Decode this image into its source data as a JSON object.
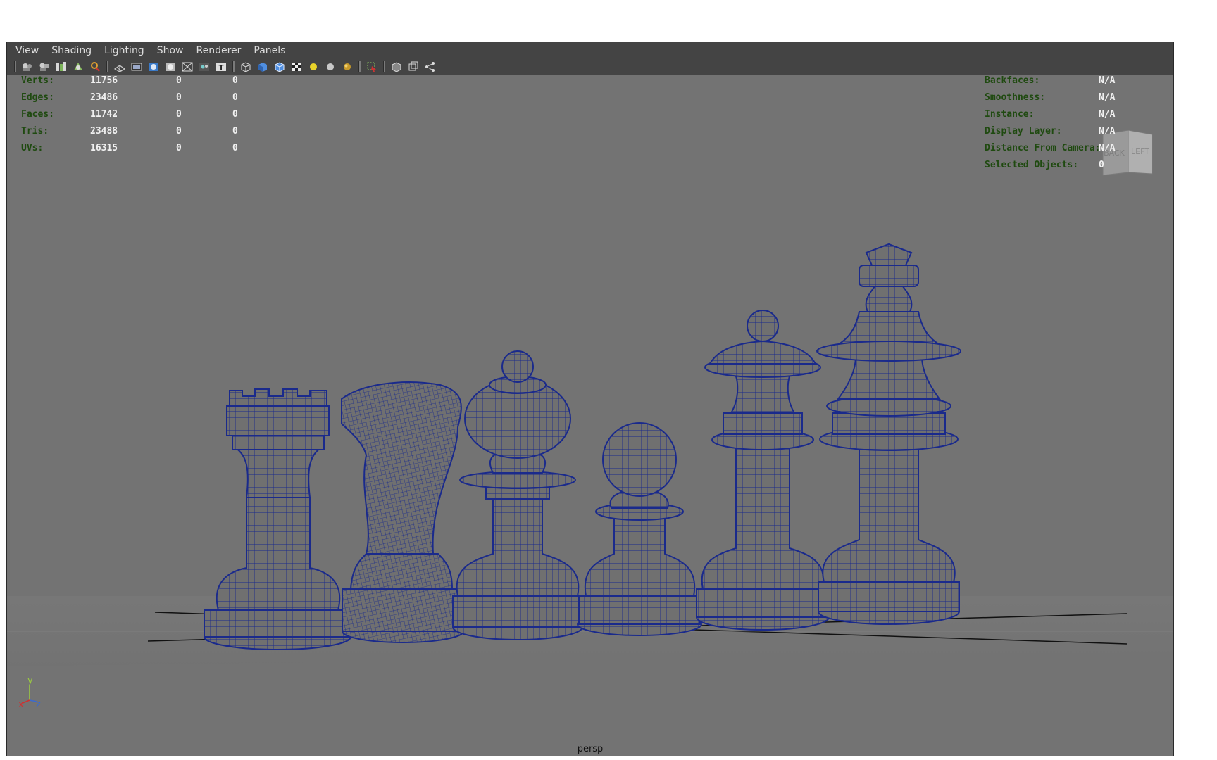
{
  "menubar": {
    "items": [
      "View",
      "Shading",
      "Lighting",
      "Show",
      "Renderer",
      "Panels"
    ]
  },
  "toolbar": {
    "icons": [
      "camera-select-icon",
      "camera-attributes-icon",
      "bookmarks-icon",
      "image-plane-icon",
      "2d-pan-zoom-icon",
      "grid-icon",
      "film-gate-icon",
      "resolution-gate-icon",
      "gate-mask-icon",
      "field-chart-icon",
      "safe-action-icon",
      "safe-title-icon",
      "wireframe-icon",
      "smooth-shade-icon",
      "wireframe-on-shaded-icon",
      "textured-icon",
      "use-default-light-icon",
      "shadows-icon",
      "screen-space-ao-icon",
      "isolate-select-icon",
      "xray-icon",
      "xray-joints-icon",
      "xray-components-icon"
    ]
  },
  "hud_left": {
    "rows": [
      {
        "label": "Verts:",
        "v1": "11756",
        "v2": "0",
        "v3": "0"
      },
      {
        "label": "Edges:",
        "v1": "23486",
        "v2": "0",
        "v3": "0"
      },
      {
        "label": "Faces:",
        "v1": "11742",
        "v2": "0",
        "v3": "0"
      },
      {
        "label": "Tris:",
        "v1": "23488",
        "v2": "0",
        "v3": "0"
      },
      {
        "label": "UVs:",
        "v1": "16315",
        "v2": "0",
        "v3": "0"
      }
    ]
  },
  "hud_right": {
    "rows": [
      {
        "label": "Backfaces:",
        "value": "N/A"
      },
      {
        "label": "Smoothness:",
        "value": "N/A"
      },
      {
        "label": "Instance:",
        "value": "N/A"
      },
      {
        "label": "Display Layer:",
        "value": "N/A"
      },
      {
        "label": "Distance From Camera:",
        "value": "N/A"
      },
      {
        "label": "Selected Objects:",
        "value": "0"
      }
    ]
  },
  "viewcube": {
    "back": "BACK",
    "left": "LEFT"
  },
  "axis": {
    "x": "x",
    "y": "y",
    "z": "z"
  },
  "camera_label": "persp",
  "colors": {
    "viewport_bg": "#737373",
    "wire": "#1a2a8c",
    "piece_fill": "#6f6f6f",
    "hud_label": "#1f4a10",
    "hud_value": "#f0f0f0"
  }
}
